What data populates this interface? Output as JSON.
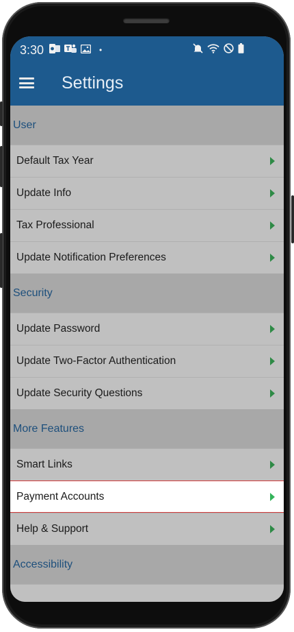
{
  "status_bar": {
    "time": "3:30",
    "left_icons": [
      "outlook-icon",
      "teams-icon",
      "gallery-icon"
    ],
    "dot": "•",
    "right_icons": [
      "mute-icon",
      "wifi-icon",
      "do-not-disturb-icon",
      "battery-icon"
    ]
  },
  "app_bar": {
    "title": "Settings",
    "menu_icon": "hamburger-menu-icon"
  },
  "sections": [
    {
      "title": "User",
      "items": [
        {
          "label": "Default Tax Year"
        },
        {
          "label": "Update Info"
        },
        {
          "label": "Tax Professional"
        },
        {
          "label": "Update Notification Preferences"
        }
      ]
    },
    {
      "title": "Security",
      "items": [
        {
          "label": "Update Password"
        },
        {
          "label": "Update Two-Factor Authentication"
        },
        {
          "label": "Update Security Questions"
        }
      ]
    },
    {
      "title": "More Features",
      "items": [
        {
          "label": "Smart Links"
        },
        {
          "label": "Payment Accounts",
          "selected": true
        },
        {
          "label": "Help & Support"
        }
      ]
    },
    {
      "title": "Accessibility",
      "items": []
    }
  ],
  "colors": {
    "app_bar": "#1d5a8e",
    "section_title": "#1d4f7c",
    "chevron": "#2e8a46",
    "highlight_border": "#d23a3a"
  }
}
